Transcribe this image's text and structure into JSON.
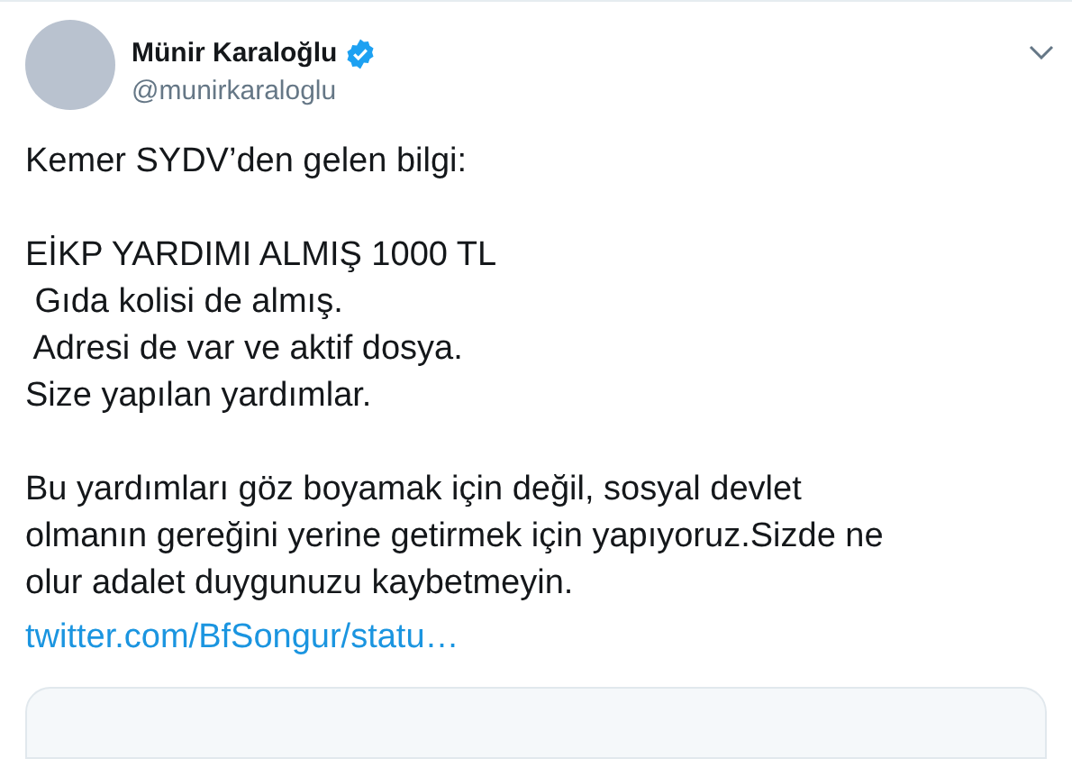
{
  "author": {
    "name": "Münir Karaloğlu",
    "verified": true,
    "handle": "@munirkaraloglu"
  },
  "paragraphs": [
    [
      "Kemer SYDV’den gelen bilgi:"
    ],
    [
      "EİKP YARDIMI ALMIŞ 1000 TL",
      " Gıda kolisi de almış.",
      " Adresi de var ve aktif dosya.",
      "Size yapılan yardımlar."
    ],
    [
      "Bu yardımları göz boyamak için değil, sosyal devlet",
      "olmanın gereğini yerine getirmek için yapıyoruz.Sizde ne",
      "olur adalet duygunuzu kaybetmeyin."
    ]
  ],
  "link": "twitter.com/BfSongur/statu…"
}
